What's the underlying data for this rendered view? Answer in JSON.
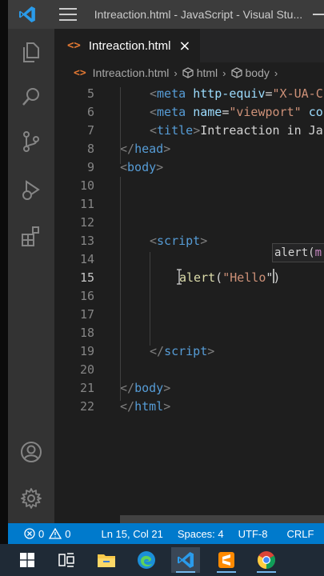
{
  "window": {
    "title": "Intreaction.html - JavaScript - Visual Stu..."
  },
  "activity_bar": {
    "icons": [
      "files-icon",
      "search-icon",
      "source-control-icon",
      "run-debug-icon",
      "extensions-icon",
      "account-icon",
      "gear-icon"
    ]
  },
  "tab": {
    "icon": "<>",
    "label": "Intreaction.html",
    "close": "×"
  },
  "breadcrumb": {
    "file_icon": "<>",
    "file": "Intreaction.html",
    "items": [
      "html",
      "body"
    ],
    "separator": "›"
  },
  "editor": {
    "lines": [
      {
        "num": "5",
        "indent": 2,
        "tokens": [
          [
            "brk",
            "<"
          ],
          [
            "tag",
            "meta"
          ],
          [
            "txt",
            " "
          ],
          [
            "attr",
            "http-equiv"
          ],
          [
            "txt",
            "="
          ],
          [
            "str",
            "\"X-UA-C"
          ]
        ]
      },
      {
        "num": "6",
        "indent": 2,
        "tokens": [
          [
            "brk",
            "<"
          ],
          [
            "tag",
            "meta"
          ],
          [
            "txt",
            " "
          ],
          [
            "attr",
            "name"
          ],
          [
            "txt",
            "="
          ],
          [
            "str",
            "\"viewport\""
          ],
          [
            "txt",
            " "
          ],
          [
            "attr",
            "co"
          ]
        ]
      },
      {
        "num": "7",
        "indent": 2,
        "tokens": [
          [
            "brk",
            "<"
          ],
          [
            "tag",
            "title"
          ],
          [
            "brk",
            ">"
          ],
          [
            "txt",
            "Intreaction in Ja"
          ]
        ]
      },
      {
        "num": "8",
        "indent": 0,
        "tokens": [
          [
            "brk",
            "</"
          ],
          [
            "tag",
            "head"
          ],
          [
            "brk",
            ">"
          ]
        ]
      },
      {
        "num": "9",
        "indent": 0,
        "tokens": [
          [
            "brk",
            "<"
          ],
          [
            "tag",
            "body"
          ],
          [
            "brk",
            ">"
          ]
        ]
      },
      {
        "num": "10",
        "indent": 0,
        "tokens": []
      },
      {
        "num": "11",
        "indent": 0,
        "tokens": []
      },
      {
        "num": "12",
        "indent": 0,
        "tokens": []
      },
      {
        "num": "13",
        "indent": 2,
        "tokens": [
          [
            "brk",
            "<"
          ],
          [
            "tag",
            "script"
          ],
          [
            "brk",
            ">"
          ]
        ]
      },
      {
        "num": "14",
        "indent": 0,
        "tokens": []
      },
      {
        "num": "15",
        "indent": 4,
        "active": true,
        "tokens": [
          [
            "fn",
            "alert"
          ],
          [
            "txt",
            "("
          ],
          [
            "str",
            "\"Hello"
          ],
          [
            "txt",
            "\")"
          ]
        ]
      },
      {
        "num": "16",
        "indent": 0,
        "tokens": []
      },
      {
        "num": "17",
        "indent": 0,
        "tokens": []
      },
      {
        "num": "18",
        "indent": 0,
        "tokens": []
      },
      {
        "num": "19",
        "indent": 2,
        "tokens": [
          [
            "brk",
            "</"
          ],
          [
            "tag",
            "script"
          ],
          [
            "brk",
            ">"
          ]
        ]
      },
      {
        "num": "20",
        "indent": 0,
        "tokens": []
      },
      {
        "num": "21",
        "indent": 0,
        "tokens": [
          [
            "brk",
            "</"
          ],
          [
            "tag",
            "body"
          ],
          [
            "brk",
            ">"
          ]
        ]
      },
      {
        "num": "22",
        "indent": 0,
        "tokens": [
          [
            "brk",
            "</"
          ],
          [
            "tag",
            "html"
          ],
          [
            "brk",
            ">"
          ]
        ]
      }
    ],
    "hover": {
      "fn": "alert(",
      "param": "m"
    }
  },
  "status_bar": {
    "errors": "0",
    "warnings": "0",
    "position": "Ln 15, Col 21",
    "spaces": "Spaces: 4",
    "encoding": "UTF-8",
    "eol": "CRLF"
  },
  "taskbar": {
    "apps": [
      "windows-start-icon",
      "task-view-icon",
      "file-explorer-icon",
      "edge-icon",
      "vscode-icon",
      "sublime-text-icon",
      "chrome-icon"
    ]
  },
  "colors": {
    "status_bar": "#007acc",
    "activity_bar": "#333333",
    "editor_bg": "#1e1e1e",
    "html_icon": "#e37933"
  }
}
